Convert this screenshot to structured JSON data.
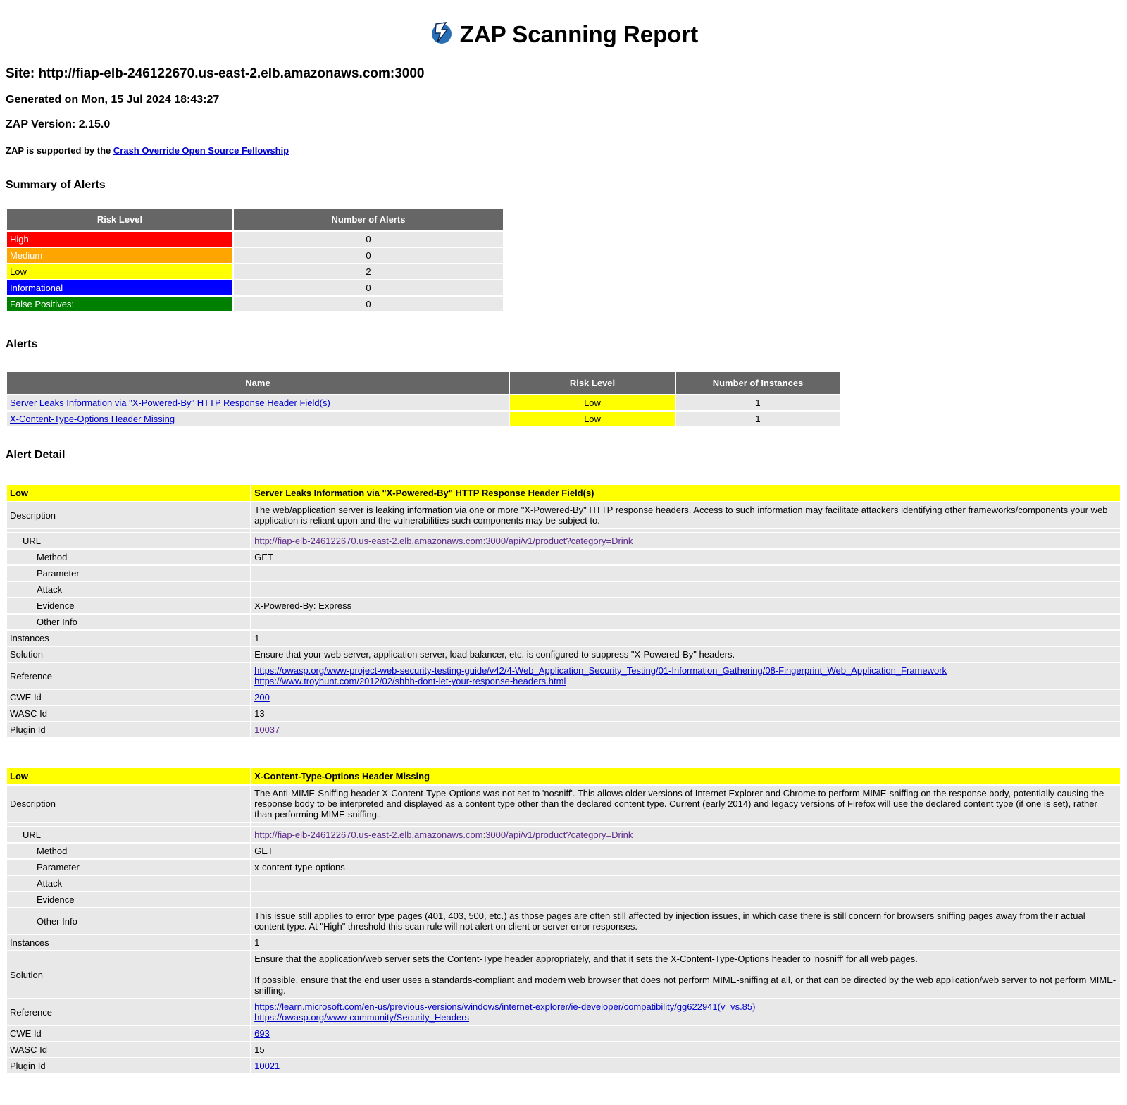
{
  "report": {
    "title": "ZAP Scanning Report",
    "site": "Site: http://fiap-elb-246122670.us-east-2.elb.amazonaws.com:3000",
    "generated": "Generated on Mon, 15 Jul 2024 18:43:27",
    "version": "ZAP Version: 2.15.0",
    "support_prefix": "ZAP is supported by the ",
    "support_link": "Crash Override Open Source Fellowship"
  },
  "summary": {
    "heading": "Summary of Alerts",
    "col_risk": "Risk Level",
    "col_count": "Number of Alerts",
    "rows": [
      {
        "label": "High",
        "count": "0",
        "color": "#ff0000"
      },
      {
        "label": "Medium",
        "count": "0",
        "color": "#ffa500"
      },
      {
        "label": "Low",
        "count": "2",
        "color": "#ffff00"
      },
      {
        "label": "Informational",
        "count": "0",
        "color": "#0000ff"
      },
      {
        "label": "False Positives:",
        "count": "0",
        "color": "#008000"
      }
    ]
  },
  "alerts": {
    "heading": "Alerts",
    "col_name": "Name",
    "col_risk": "Risk Level",
    "col_instances": "Number of Instances",
    "rows": [
      {
        "name": "Server Leaks Information via \"X-Powered-By\" HTTP Response Header Field(s)",
        "risk": "Low",
        "instances": "1"
      },
      {
        "name": "X-Content-Type-Options Header Missing",
        "risk": "Low",
        "instances": "1"
      }
    ]
  },
  "detail": {
    "heading": "Alert Detail",
    "labels": {
      "description": "Description",
      "url": "URL",
      "method": "Method",
      "parameter": "Parameter",
      "attack": "Attack",
      "evidence": "Evidence",
      "other_info": "Other Info",
      "instances": "Instances",
      "solution": "Solution",
      "reference": "Reference",
      "cwe": "CWE Id",
      "wasc": "WASC Id",
      "plugin": "Plugin Id"
    },
    "items": [
      {
        "risk": "Low",
        "name": "Server Leaks Information via \"X-Powered-By\" HTTP Response Header Field(s)",
        "description": "The web/application server is leaking information via one or more \"X-Powered-By\" HTTP response headers. Access to such information may facilitate attackers identifying other frameworks/components your web application is reliant upon and the vulnerabilities such components may be subject to.",
        "url": "http://fiap-elb-246122670.us-east-2.elb.amazonaws.com:3000/api/v1/product?category=Drink",
        "method": "GET",
        "parameter": "",
        "attack": "",
        "evidence": "X-Powered-By: Express",
        "other_info": "",
        "instances": "1",
        "solution": "Ensure that your web server, application server, load balancer, etc. is configured to suppress \"X-Powered-By\" headers.",
        "solution2": "",
        "reference1": "https://owasp.org/www-project-web-security-testing-guide/v42/4-Web_Application_Security_Testing/01-Information_Gathering/08-Fingerprint_Web_Application_Framework",
        "reference2": "https://www.troyhunt.com/2012/02/shhh-dont-let-your-response-headers.html",
        "cwe": "200",
        "wasc": "13",
        "plugin": "10037"
      },
      {
        "risk": "Low",
        "name": "X-Content-Type-Options Header Missing",
        "description": "The Anti-MIME-Sniffing header X-Content-Type-Options was not set to 'nosniff'. This allows older versions of Internet Explorer and Chrome to perform MIME-sniffing on the response body, potentially causing the response body to be interpreted and displayed as a content type other than the declared content type. Current (early 2014) and legacy versions of Firefox will use the declared content type (if one is set), rather than performing MIME-sniffing.",
        "url": "http://fiap-elb-246122670.us-east-2.elb.amazonaws.com:3000/api/v1/product?category=Drink",
        "method": "GET",
        "parameter": "x-content-type-options",
        "attack": "",
        "evidence": "",
        "other_info": "This issue still applies to error type pages (401, 403, 500, etc.) as those pages are often still affected by injection issues, in which case there is still concern for browsers sniffing pages away from their actual content type. At \"High\" threshold this scan rule will not alert on client or server error responses.",
        "instances": "1",
        "solution": "Ensure that the application/web server sets the Content-Type header appropriately, and that it sets the X-Content-Type-Options header to 'nosniff' for all web pages.",
        "solution2": "If possible, ensure that the end user uses a standards-compliant and modern web browser that does not perform MIME-sniffing at all, or that can be directed by the web application/web server to not perform MIME-sniffing.",
        "reference1": "https://learn.microsoft.com/en-us/previous-versions/windows/internet-explorer/ie-developer/compatibility/gg622941(v=vs.85)",
        "reference2": "https://owasp.org/www-community/Security_Headers",
        "cwe": "693",
        "wasc": "15",
        "plugin": "10021"
      }
    ]
  }
}
